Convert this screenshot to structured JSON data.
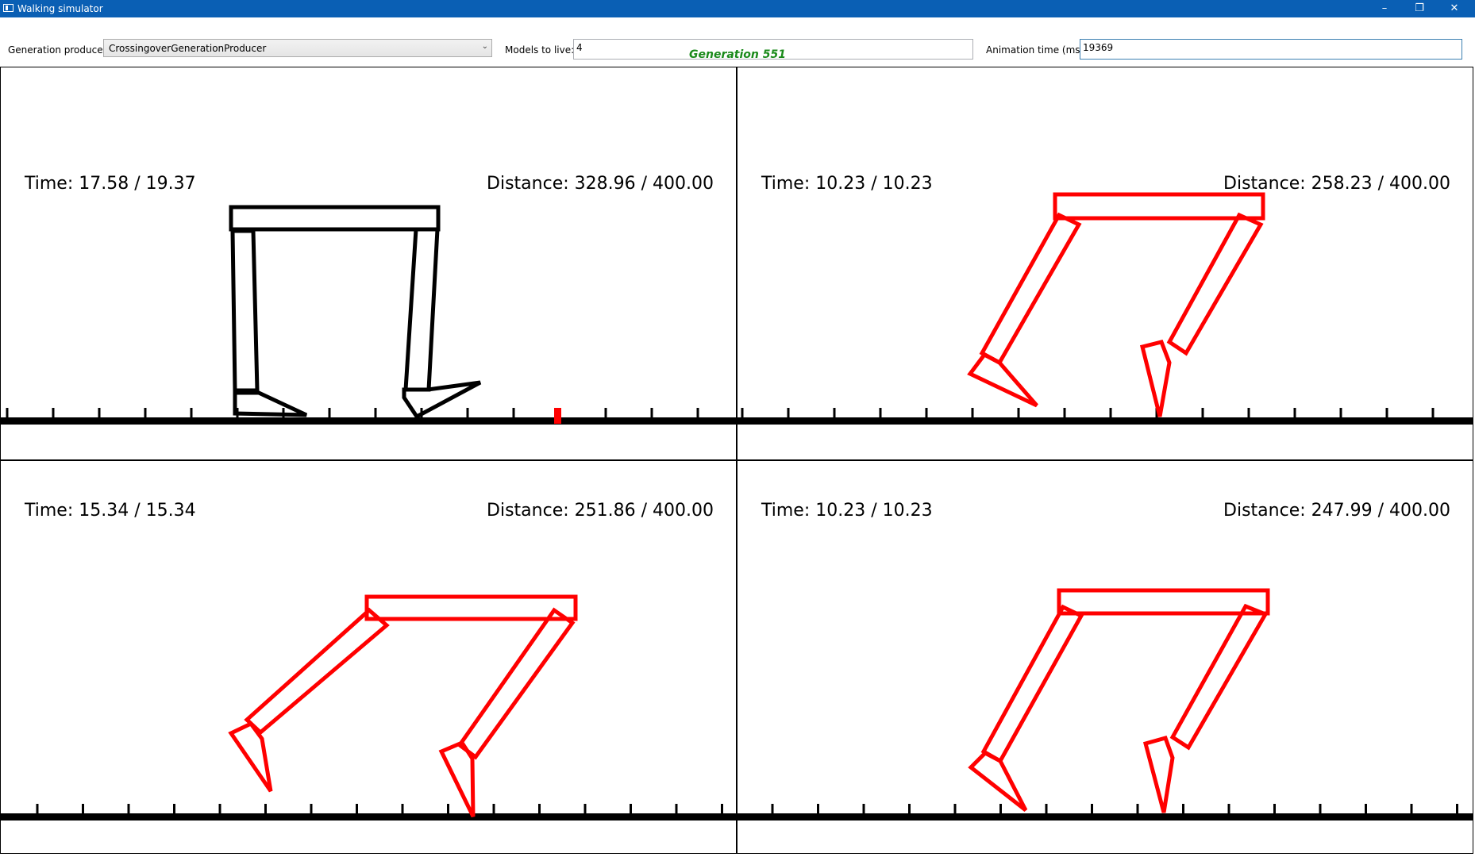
{
  "window": {
    "title": "Walking simulator"
  },
  "controls": {
    "minimize": "–",
    "restore": "❐",
    "close": "✕"
  },
  "toolbar": {
    "generation_producer_label": "Generation producer:",
    "generation_producer_value": "CrossingoverGenerationProducer",
    "models_to_live_label": "Models to live:",
    "models_to_live_value": "4",
    "animation_time_label": "Animation time (ms):",
    "animation_time_value": "19369"
  },
  "generation_label": "Generation 551",
  "colors": {
    "leader": "#000000",
    "others": "#ff0000",
    "marker": "#ff0000",
    "generation": "#1a8a1a"
  },
  "panels": [
    {
      "time": "Time: 17.58 / 19.37",
      "distance": "Distance: 328.96 / 400.00",
      "highlight": true
    },
    {
      "time": "Time: 10.23 / 10.23",
      "distance": "Distance: 258.23 / 400.00",
      "highlight": false
    },
    {
      "time": "Time: 15.34 / 15.34",
      "distance": "Distance: 251.86 / 400.00",
      "highlight": false
    },
    {
      "time": "Time: 10.23 / 10.23",
      "distance": "Distance: 247.99 / 400.00",
      "highlight": false
    }
  ]
}
